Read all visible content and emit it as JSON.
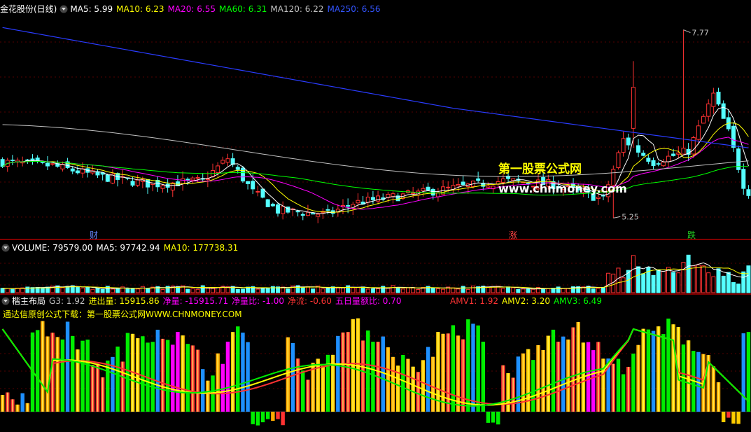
{
  "main": {
    "title": "金花股份(日线)",
    "ma": [
      {
        "label": "MA5: 5.99",
        "color": "#ffffff"
      },
      {
        "label": "MA10: 6.23",
        "color": "#ffff00"
      },
      {
        "label": "MA20: 6.55",
        "color": "#ff00ff"
      },
      {
        "label": "MA60: 6.31",
        "color": "#00ff00"
      },
      {
        "label": "MA120: 6.22",
        "color": "#c0c0c0"
      },
      {
        "label": "MA250: 6.56",
        "color": "#3355ff"
      }
    ],
    "high_label": "7.77",
    "low_label": "5.25",
    "marks": [
      {
        "text": "财",
        "color": "#6688ff",
        "x": 8
      },
      {
        "text": "涨",
        "color": "#ff4444",
        "x": 43
      },
      {
        "text": "跌",
        "color": "#22cc22",
        "x": 59
      }
    ]
  },
  "volume": {
    "label": "VOLUME: 79579.00",
    "ma5": "MA5: 97742.94",
    "ma10": "MA10: 177738.31"
  },
  "indicator": {
    "title": "楷主布局",
    "items": [
      {
        "label": "G3: 1.92",
        "color": "#c0c0c0"
      },
      {
        "label": "进出量: 15915.86",
        "color": "#ffff00"
      },
      {
        "label": "净量: -15915.71",
        "color": "#ff00ff"
      },
      {
        "label": "净量比: -1.00",
        "color": "#ff00ff"
      },
      {
        "label": "净流: -0.60",
        "color": "#ff3333"
      },
      {
        "label": "五日量额比: 0.70",
        "color": "#ff00ff"
      }
    ],
    "amv": [
      {
        "label": "AMV1: 1.92",
        "color": "#ff3333"
      },
      {
        "label": "AMV2: 3.20",
        "color": "#ffff00"
      },
      {
        "label": "AMV3: 6.49",
        "color": "#00ff00"
      }
    ],
    "note": "通达信原创公式下载：第一股票公式网WWW.CHNMONEY.COM"
  },
  "watermark": {
    "cn": "第一股票公式网",
    "url": "www.chnmoney.com"
  },
  "chart_data": {
    "type": "candlestick",
    "price_range": [
      5.0,
      8.0
    ],
    "high": 7.77,
    "low": 5.25,
    "ma_final": {
      "MA5": 5.99,
      "MA10": 6.23,
      "MA20": 6.55,
      "MA60": 6.31,
      "MA120": 6.22,
      "MA250": 6.56
    },
    "volume_last": 79579.0
  }
}
